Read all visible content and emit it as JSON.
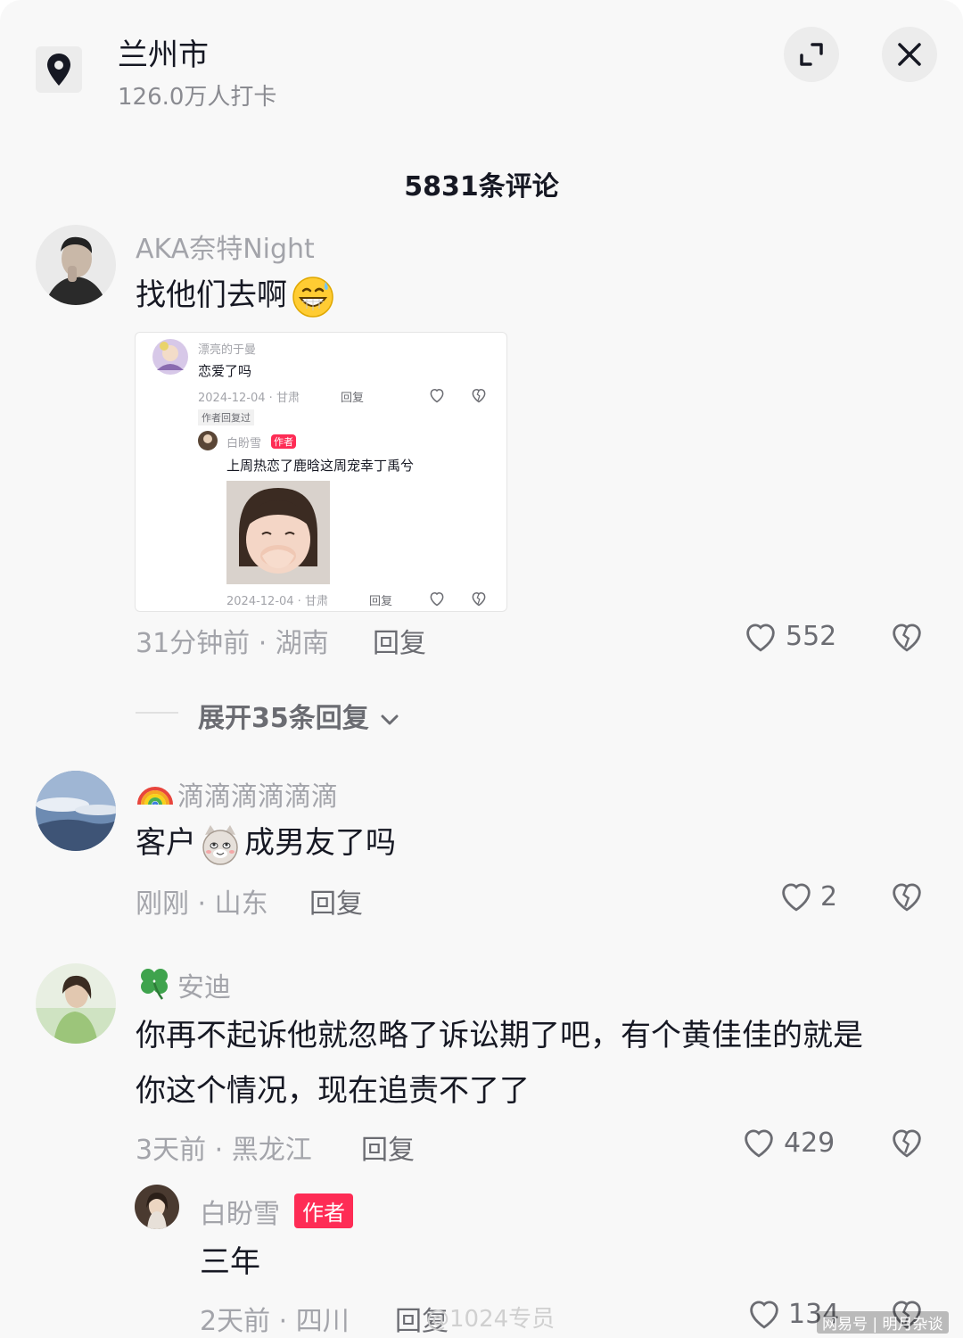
{
  "header": {
    "location_title": "兰州市",
    "checkins": "126.0万人打卡"
  },
  "comment_count": "5831条评论",
  "comments": [
    {
      "username": "AKA奈特Night",
      "text": "找他们去啊",
      "time_loc": "31分钟前 · 湖南",
      "reply": "回复",
      "likes": "552",
      "expand": "展开35条回复"
    },
    {
      "username": "滴滴滴滴滴滴",
      "text_before": "客户",
      "text_after": "成男友了吗",
      "time_loc": "刚刚 · 山东",
      "reply": "回复",
      "likes": "2"
    },
    {
      "username": "安迪",
      "text_line1": "你再不起诉他就忽略了诉讼期了吧，有个黄佳佳的就是",
      "text_line2": "你这个情况，现在追责不了了",
      "time_loc": "3天前 · 黑龙江",
      "reply": "回复",
      "likes": "429"
    },
    {
      "username": "白盼雪",
      "badge": "作者",
      "text": "三年",
      "time_loc": "2天前 · 四川",
      "reply": "回复",
      "likes": "134"
    }
  ],
  "screenshot": {
    "user": "漂亮的于曼",
    "text": "恋爱了吗",
    "date_loc": "2024-12-04 · 甘肃",
    "reply": "回复",
    "author_replied": "作者回复过",
    "sub_user": "白盼雪",
    "sub_badge": "作者",
    "sub_text": "上周热恋了鹿晗这周宠幸丁禹兮",
    "sub_date": "2024-12-04 · 甘肃",
    "sub_reply": "回复"
  },
  "watermarks": {
    "weibo": "@1024专员",
    "netease": "网易号 | 明月杂谈"
  },
  "colors": {
    "accent": "#fe2c55",
    "text": "#161823",
    "muted": "#a3a4aa",
    "background": "#f8f8f8"
  }
}
